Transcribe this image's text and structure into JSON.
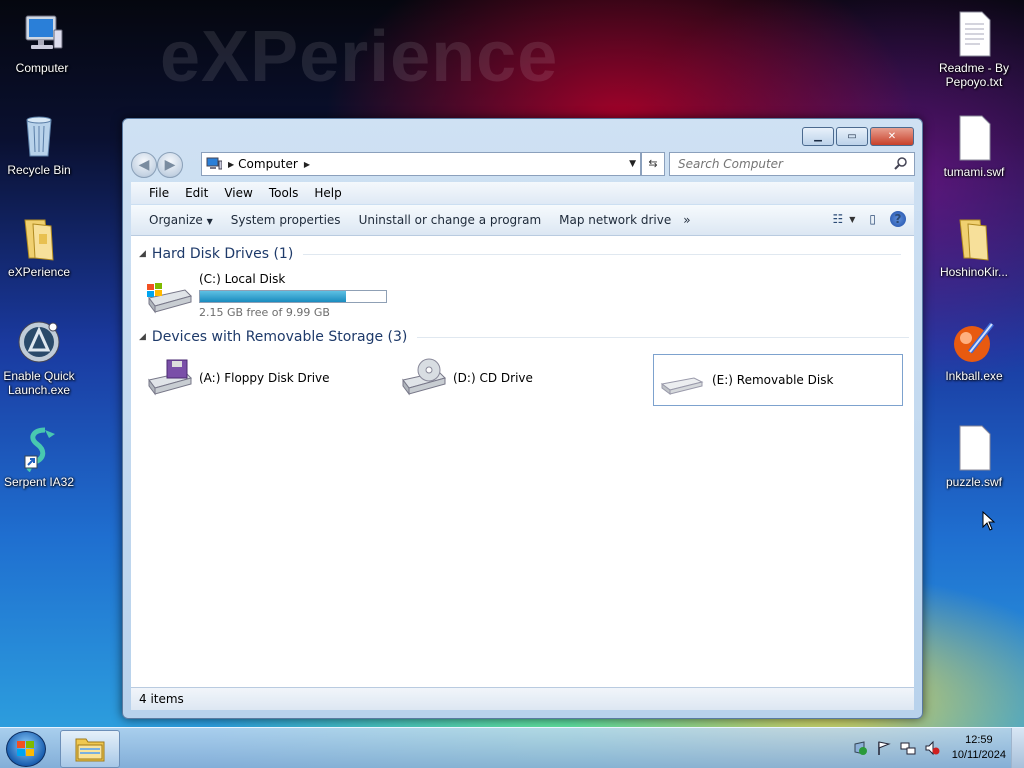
{
  "desktop": {
    "watermark": "eXPerience",
    "left_icons": [
      {
        "label": "Computer",
        "icon": "computer-icon"
      },
      {
        "label": "Recycle Bin",
        "icon": "recycle-bin-icon"
      },
      {
        "label": "eXPerience",
        "icon": "folder-icon"
      },
      {
        "label": "Enable Quick Launch.exe",
        "icon": "quick-launch-icon"
      },
      {
        "label": "Serpent IA32",
        "icon": "serpent-icon"
      }
    ],
    "right_icons": [
      {
        "label": "Readme - By Pepoyo.txt",
        "icon": "text-file-icon"
      },
      {
        "label": "tumami.swf",
        "icon": "file-icon"
      },
      {
        "label": "HoshinoKir...",
        "icon": "folder-icon"
      },
      {
        "label": "Inkball.exe",
        "icon": "inkball-icon"
      },
      {
        "label": "puzzle.swf",
        "icon": "file-icon"
      }
    ]
  },
  "window": {
    "breadcrumb": "Computer",
    "search_placeholder": "Search Computer",
    "menu": [
      "File",
      "Edit",
      "View",
      "Tools",
      "Help"
    ],
    "toolbar": {
      "organize": "Organize",
      "system_properties": "System properties",
      "uninstall": "Uninstall or change a program",
      "map_drive": "Map network drive",
      "more": "»"
    },
    "groups": {
      "hard_disks": "Hard Disk Drives (1)",
      "removable": "Devices with Removable Storage (3)"
    },
    "drives": {
      "c": {
        "label": "(C:) Local Disk",
        "free_text": "2.15 GB free of 9.99 GB",
        "used_fraction": 0.785
      },
      "a": {
        "label": "(A:) Floppy Disk Drive"
      },
      "d": {
        "label": "(D:) CD Drive"
      },
      "e": {
        "label": "(E:) Removable Disk"
      }
    },
    "status": "4 items"
  },
  "taskbar": {
    "time": "12:59",
    "date": "10/11/2024"
  },
  "colors": {
    "capacity_fill": "#1a8cbf",
    "close_button": "#c7402a"
  }
}
